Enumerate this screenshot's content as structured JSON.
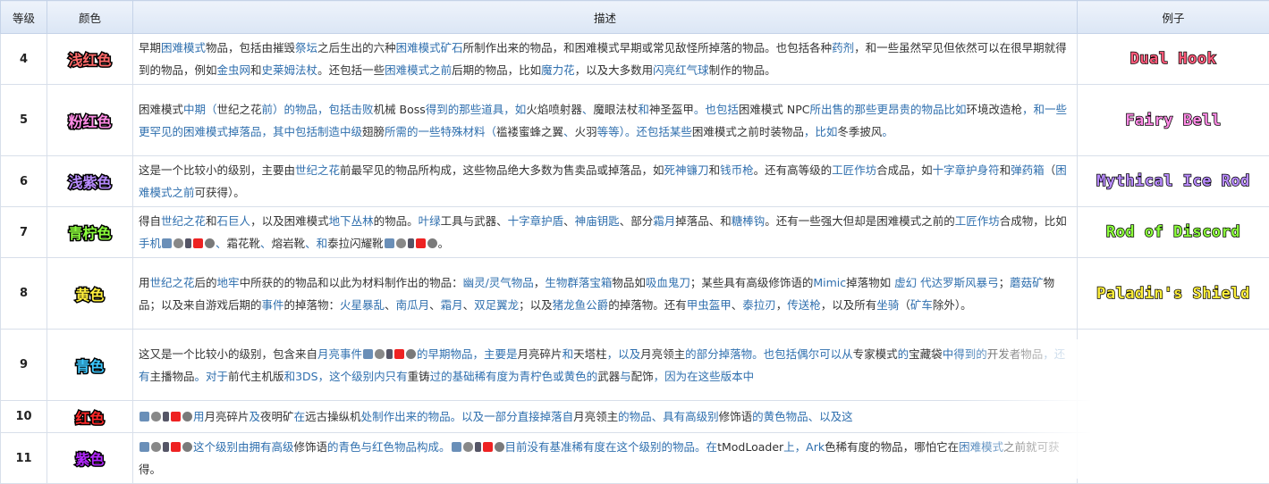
{
  "headers": {
    "level": "等级",
    "color": "颜色",
    "desc": "描述",
    "example": "例子"
  },
  "rows": [
    {
      "level": "4",
      "color_name": "浅红色",
      "color_hex": "#ff6a6a",
      "example": "Dual Hook",
      "example_hex": "#ff5a7a",
      "desc": [
        "早期",
        "困难模式",
        "物品，包括由摧毁",
        "祭坛",
        "之后生出的六种",
        "困难模式矿石",
        "所制作出来的物品，和困难模式早期或常见敌怪所掉落的物品。也包括各种",
        "药剂",
        "，和一些虽然罕见但依然可以在很早期就得到的物品，例如",
        "金虫网",
        "和",
        "史莱姆法杖",
        "。还包括一些",
        "困难模式之前",
        "后期的物品，比如",
        "魔力花",
        "，以及大多数用",
        "闪亮红气球",
        "制作的物品。"
      ]
    },
    {
      "level": "5",
      "color_name": "粉红色",
      "color_hex": "#ff8ce6",
      "example": "Fairy Bell",
      "example_hex": "#ff8ce6",
      "desc": [
        "困难模式",
        "中期（",
        "世纪之花",
        "前）的物品，包括击败",
        "机械 Boss",
        "得到的那些道具，如",
        "火焰喷射器",
        "、",
        "魔眼法杖",
        "和",
        "神圣盔甲",
        "。也包括",
        "困难模式 NPC",
        "所出售的那些更昂贵的物品比如",
        "环境改造枪",
        "，和一些更罕见的困难模式掉落品，其中包括制造中级",
        "翅膀",
        "所需的一些特殊材料（",
        "褴褛蜜蜂之翼",
        "、",
        "火羽",
        "等等）。还包括某些",
        "困难模式之前时装物品",
        "，比如",
        "冬季披风",
        "。"
      ]
    },
    {
      "level": "6",
      "color_name": "浅紫色",
      "color_hex": "#b98cff",
      "example": "Mythical Ice Rod",
      "example_hex": "#b98cff",
      "desc": [
        "这是一个比较小的级别，主要由",
        "世纪之花",
        "前最罕见的物品所构成，这些物品绝大多数为售卖品或掉落品，如",
        "死神镰刀",
        "和",
        "钱币枪",
        "。还有高等级的",
        "工匠作坊",
        "合成品，如",
        "十字章护身符",
        "和",
        "弹药箱",
        "（",
        "困难模式之前",
        "可获得）。"
      ]
    },
    {
      "level": "7",
      "color_name": "青柠色",
      "color_hex": "#8cff3c",
      "example": "Rod of Discord",
      "example_hex": "#8cff3c",
      "desc": [
        "得自",
        "世纪之花",
        "和",
        "石巨人",
        "，以及困难模式",
        "地下丛林",
        "的物品。",
        "叶绿",
        "工具与武器、",
        "十字章护盾",
        "、",
        "神庙钥匙",
        "、部分",
        "霜月",
        "掉落品、和",
        "糖棒钩",
        "。还有一些强大但却是困难模式之前的",
        "工匠作坊",
        "合成物，比如",
        "手机",
        "",
        "、",
        "霜花靴",
        "、",
        "熔岩靴",
        "、和",
        "泰拉闪耀靴",
        "",
        "。"
      ]
    },
    {
      "level": "8",
      "color_name": "黄色",
      "color_hex": "#ffef3c",
      "example": "Paladin's Shield",
      "example_hex": "#ffef3c",
      "desc": [
        "用",
        "世纪之花",
        "后的",
        "地牢",
        "中所获的的物品和以此为材料制作出的物品：",
        "幽灵/灵气物品",
        "，",
        "生物群落宝箱",
        "物品如",
        "吸血鬼刀",
        "；某些具有高级修饰语的",
        "Mimic",
        "掉落物如 ",
        "虚幻 代达罗斯风暴弓",
        "；",
        "蘑菇矿",
        "物品；以及来自游戏后期的",
        "事件",
        "的掉落物：",
        "火星暴乱",
        "、",
        "南瓜月",
        "、",
        "霜月",
        "、",
        "双足翼龙",
        "；以及",
        "猪龙鱼公爵",
        "的掉落物。还有",
        "甲虫盔甲",
        "、",
        "泰拉刃",
        "，",
        "传送枪",
        "，以及所有",
        "坐骑",
        "（",
        "矿车",
        "除外）。"
      ]
    },
    {
      "level": "9",
      "color_name": "青色",
      "color_hex": "#3cc8ff",
      "example": "",
      "example_hex": "#3cc8ff",
      "desc": [
        "这又是一个比较小的级别，包含来自",
        "月亮事件",
        "",
        "的早期物品，主要是",
        "月亮碎片",
        "和",
        "天塔柱",
        "，以及",
        "月亮领主",
        "的部分掉落物。也包括偶尔可以从",
        "专家模式",
        "的",
        "宝藏袋",
        "中得到的",
        "开发者物品",
        "，还有",
        "主播物品",
        "。对于",
        "前代主机版",
        "和3DS，这个级别内只有",
        "重铸",
        "过的基础稀有度为青柠色或黄色的",
        "武器",
        "与",
        "配饰",
        "，因为在这些版本中"
      ]
    },
    {
      "level": "10",
      "color_name": "红色",
      "color_hex": "#ff2828",
      "example": "",
      "example_hex": "#ff2828",
      "desc": [
        "",
        "用",
        "月亮碎片",
        "及",
        "夜明矿",
        "在",
        "远古操纵机",
        "处制作出来的物品。以及一部分直接掉落自",
        "月亮领主",
        "的物品、具有高级别",
        "修饰语",
        "的黄色物品、以及这"
      ]
    },
    {
      "level": "11",
      "color_name": "紫色",
      "color_hex": "#b428ff",
      "example": "",
      "example_hex": "#b428ff",
      "desc": [
        "",
        "这个级别由拥有高级",
        "修饰语",
        "的青色与红色物品构成。",
        "",
        "目前没有基准稀有度在这个级别的物品。在",
        "tModLoader",
        "上，Ark",
        "色稀有度的物品，哪怕它在",
        "困难模式",
        "之前就可获得。"
      ]
    }
  ],
  "link_indices_note": ""
}
